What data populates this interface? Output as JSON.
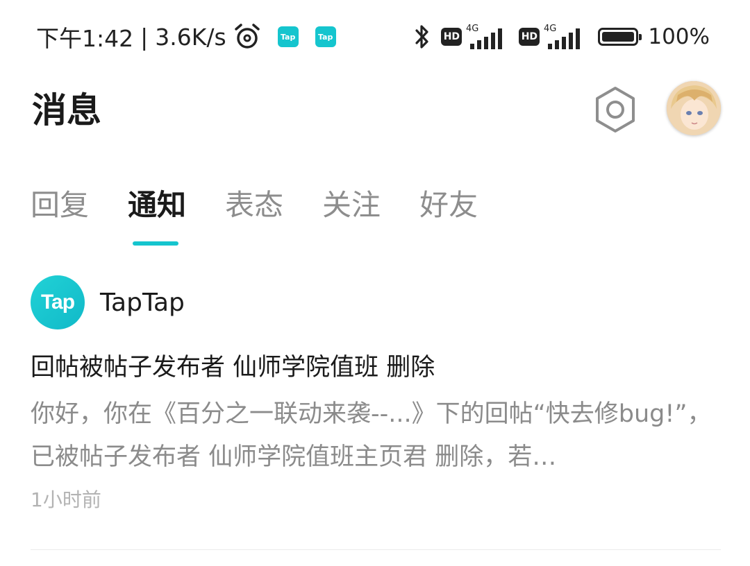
{
  "status_bar": {
    "time": "下午1:42",
    "separator": "|",
    "net_speed": "3.6K/s",
    "alarm_icon": "alarm-icon",
    "app_icon_label": "Tap",
    "hd_label": "HD",
    "network_type": "4G",
    "battery_percent": "100%",
    "battery_level": 1.0
  },
  "header": {
    "title": "消息",
    "settings_icon": "hexagon-settings-icon",
    "avatar": "user-avatar"
  },
  "tabs": [
    {
      "label": "回复",
      "active": false
    },
    {
      "label": "通知",
      "active": true
    },
    {
      "label": "表态",
      "active": false
    },
    {
      "label": "关注",
      "active": false
    },
    {
      "label": "好友",
      "active": false
    }
  ],
  "notification": {
    "logo_text": "Tap",
    "sender": "TapTap",
    "title": "回帖被帖子发布者 仙师学院值班 删除",
    "body": "你好，你在《百分之一联动来袭--...》下的回帖“快去修bug!”，已被帖子发布者 仙师学院值班主页君 删除，若…",
    "time": "1小时前"
  },
  "colors": {
    "accent": "#15c5ce",
    "text_primary": "#1a1a1a",
    "text_secondary": "#8b8b8b",
    "text_tertiary": "#b3b3b3"
  }
}
